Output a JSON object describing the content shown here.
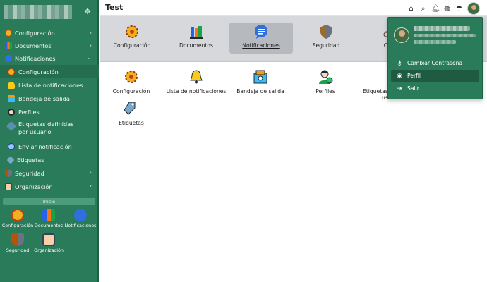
{
  "app": {
    "title": "Test"
  },
  "colors": {
    "sidebar": "#2a7b5a",
    "accent": "#2a7b5a",
    "module_bar": "#d7d8db"
  },
  "sidebar": {
    "nav": [
      {
        "label": "Configuración",
        "icon": "gear-icon",
        "expanded": false
      },
      {
        "label": "Documentos",
        "icon": "books-icon",
        "expanded": false
      },
      {
        "label": "Notificaciones",
        "icon": "chat-bubble-icon",
        "expanded": true
      }
    ],
    "notifications_children": [
      {
        "label": "Configuración",
        "icon": "gear-icon"
      },
      {
        "label": "Lista de notificaciones",
        "icon": "bell-icon"
      },
      {
        "label": "Bandeja de salida",
        "icon": "outbox-icon"
      },
      {
        "label": "Perfiles",
        "icon": "user-check-icon"
      },
      {
        "label": "Etiquetas definidas por usuario",
        "icon": "tags-icon"
      },
      {
        "label": "Enviar notificación",
        "icon": "send-icon"
      },
      {
        "label": "Etiquetas",
        "icon": "tag-icon"
      }
    ],
    "nav_bottom": [
      {
        "label": "Seguridad",
        "icon": "shield-icon"
      },
      {
        "label": "Organización",
        "icon": "org-chart-icon"
      }
    ],
    "inicio_label": "Inicio",
    "quick_links": [
      {
        "label": "Configuración",
        "icon": "gear-icon"
      },
      {
        "label": "Documentos",
        "icon": "books-icon"
      },
      {
        "label": "Notificaciones",
        "icon": "chat-bubble-icon"
      },
      {
        "label": "Seguridad",
        "icon": "shield-icon"
      },
      {
        "label": "Organización",
        "icon": "org-chart-icon"
      }
    ]
  },
  "modules": [
    {
      "label": "Configuración",
      "icon": "gear-icon"
    },
    {
      "label": "Documentos",
      "icon": "books-icon"
    },
    {
      "label": "Notificaciones",
      "icon": "chat-bubble-icon",
      "active": true
    },
    {
      "label": "Seguridad",
      "icon": "shield-icon"
    },
    {
      "label": "Orga",
      "icon": "org-chart-icon"
    }
  ],
  "main_items": [
    {
      "label": "Configuración",
      "icon": "gear-icon"
    },
    {
      "label": "Lista de notificaciones",
      "icon": "bell-icon"
    },
    {
      "label": "Bandeja de salida",
      "icon": "outbox-icon"
    },
    {
      "label": "Perfiles",
      "icon": "user-check-icon"
    },
    {
      "label": "Etiquetas d",
      "label2": "usu",
      "icon": "tags-icon"
    },
    {
      "label": "Etiquetas",
      "icon": "tag-icon"
    }
  ],
  "user_menu": {
    "items": [
      {
        "label": "Cambiar Contraseña",
        "icon": "key-icon"
      },
      {
        "label": "Perfil",
        "icon": "user-circle-icon",
        "active": true
      },
      {
        "label": "Salir",
        "icon": "logout-icon"
      }
    ]
  }
}
